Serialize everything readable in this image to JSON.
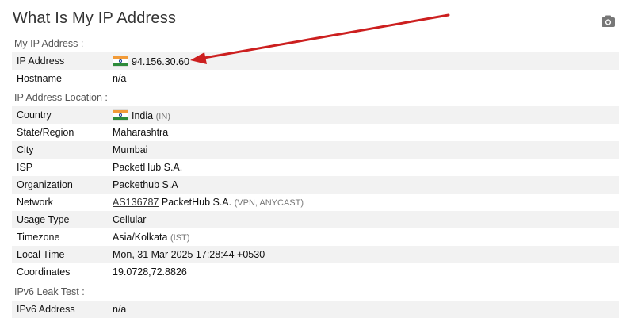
{
  "title": "What Is My IP Address",
  "icons": {
    "camera": "camera-icon",
    "flag": "india-flag-icon"
  },
  "sections": {
    "my_ip": "My IP Address :",
    "location": "IP Address Location :",
    "ipv6": "IPv6 Leak Test :"
  },
  "ip": {
    "label": "IP Address",
    "value": "94.156.30.60",
    "hostname_label": "Hostname",
    "hostname_value": "n/a"
  },
  "location": {
    "country_label": "Country",
    "country_value": "India",
    "country_code": "(IN)",
    "state_label": "State/Region",
    "state_value": "Maharashtra",
    "city_label": "City",
    "city_value": "Mumbai",
    "isp_label": "ISP",
    "isp_value": "PacketHub S.A.",
    "org_label": "Organization",
    "org_value": "Packethub S.A",
    "network_label": "Network",
    "network_asn": "AS136787",
    "network_name": "PacketHub S.A.",
    "network_tag": "(VPN, ANYCAST)",
    "usage_label": "Usage Type",
    "usage_value": "Cellular",
    "tz_label": "Timezone",
    "tz_value": "Asia/Kolkata",
    "tz_abbr": "(IST)",
    "time_label": "Local Time",
    "time_value": "Mon, 31 Mar 2025 17:28:44 +0530",
    "coord_label": "Coordinates",
    "coord_value": "19.0728,72.8826"
  },
  "ipv6": {
    "label": "IPv6 Address",
    "value": "n/a"
  },
  "colors": {
    "arrow": "#cc1f1f",
    "row_shade": "#f2f2f2"
  }
}
